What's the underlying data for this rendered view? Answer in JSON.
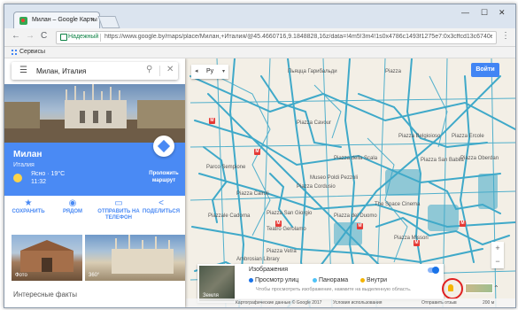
{
  "browser": {
    "tab_title": "Милан – Google Карты",
    "tab_close": "×",
    "window_minimize": "—",
    "window_maximize": "☐",
    "window_close": "✕",
    "nav_back": "←",
    "nav_forward": "→",
    "nav_reload": "C",
    "secure_label": "Надежный",
    "url": "https://www.google.by/maps/place/Милан,+Италия/@45.4660716,9.1848828,16z/data=!4m5!3m4!1s0x4786c1493f1275e7:0x3cffcd13c6740e8d!",
    "menu": "⋮",
    "bookmarks_label": "Сервисы"
  },
  "search": {
    "menu_icon": "☰",
    "query": "Милан, Италия",
    "search_icon": "⚲",
    "clear_icon": "✕"
  },
  "place": {
    "name": "Милан",
    "country": "Италия",
    "weather": "Ясно · 19°C",
    "time": "11:32",
    "route_label": "Проложить маршрут"
  },
  "actions": [
    {
      "icon": "★",
      "label": "СОХРАНИТЬ"
    },
    {
      "icon": "◉",
      "label": "РЯДОМ"
    },
    {
      "icon": "▭",
      "label": "ОТПРАВИТЬ НА ТЕЛЕФОН"
    },
    {
      "icon": "<",
      "label": "ПОДЕЛИТЬСЯ"
    }
  ],
  "photos": [
    {
      "label": "Фото"
    },
    {
      "label": "360°"
    }
  ],
  "facts_heading": "Интересные факты",
  "map": {
    "collapse_arrow": "◂",
    "language": "Ру",
    "language_arrow": "▾",
    "signin": "Войти",
    "zoom_in": "+",
    "zoom_out": "−",
    "earth_label": "Земля",
    "layers_title": "Изображения",
    "layer_options": [
      "Просмотр улиц",
      "Панорама",
      "Внутри"
    ],
    "layers_hint": "Чтобы просмотреть изображение, нажмите на выделенную область.",
    "up_arrow": "⌃",
    "metro": "M",
    "labels": [
      "Пьяцца Гарибальди",
      "Piazza",
      "Parco Sempione",
      "Piazza Cairoli",
      "Piazzale Cadorna",
      "Piazza della Scala",
      "Piazza Cordusio",
      "The Space Cinema",
      "Piazza San Babila",
      "Piazza Oberdan",
      "Piazza Cavour",
      "Piazza Belgioioso",
      "Piazza Ercole",
      "Piazza San Giorgio",
      "Museo Poldi Pezzoli",
      "Piazza del Duomo",
      "Piazza Missori",
      "Teatro Gerolamo",
      "Piazza Vetra",
      "Ambrosian Library"
    ],
    "footer": [
      "Картографические данные © Google 2017",
      "Условия использования",
      "Отправить отзыв",
      "200 м"
    ]
  }
}
